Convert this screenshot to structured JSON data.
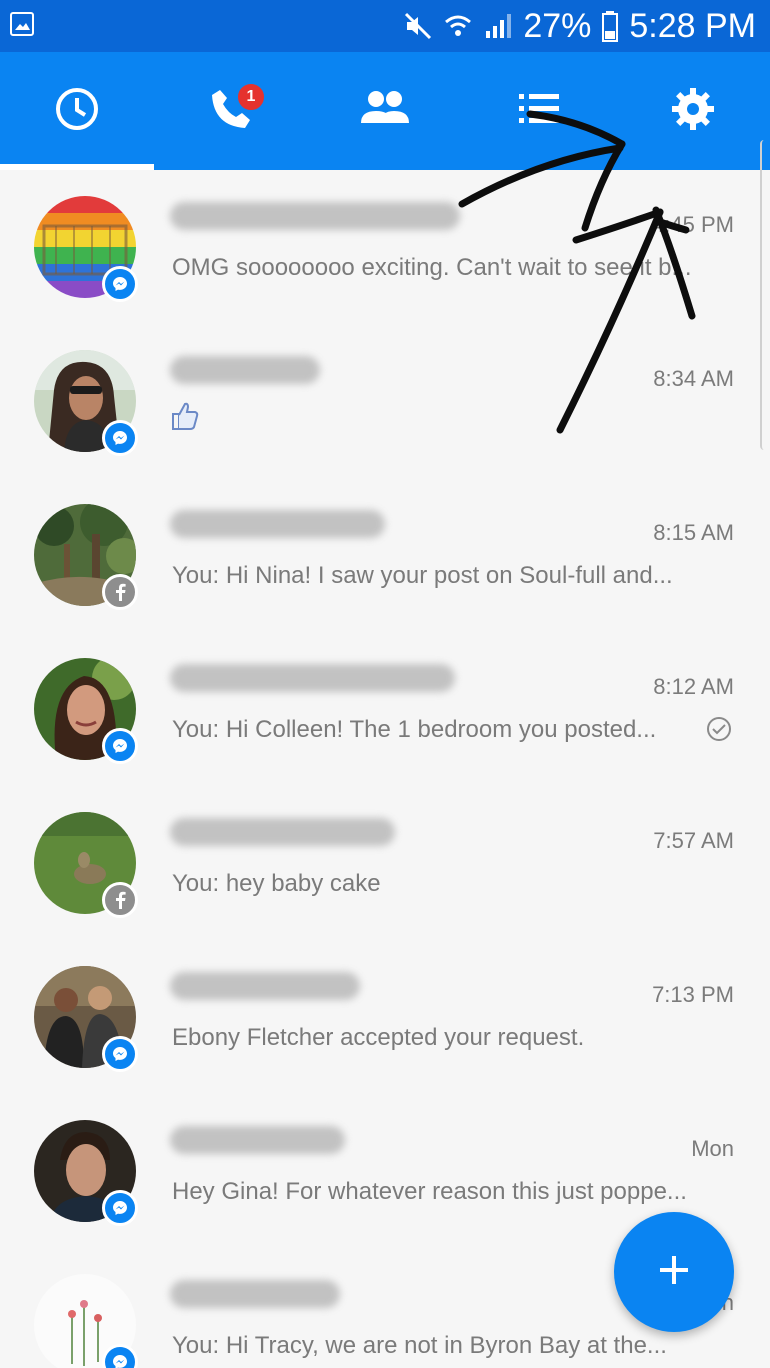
{
  "status_bar": {
    "battery": "27%",
    "time": "5:28 PM",
    "icons": [
      "image-icon",
      "mute-icon",
      "wifi-icon",
      "signal-icon",
      "battery-icon"
    ]
  },
  "tabs": [
    {
      "name": "recent",
      "icon": "clock-icon"
    },
    {
      "name": "calls",
      "icon": "phone-icon",
      "badge": "1"
    },
    {
      "name": "people",
      "icon": "people-icon"
    },
    {
      "name": "groups",
      "icon": "list-icon"
    },
    {
      "name": "settings",
      "icon": "gear-icon"
    }
  ],
  "conversations": [
    {
      "time": "4:45 PM",
      "preview": "OMG soooooooo exciting. Can't wait to see it b...",
      "badge": "messenger"
    },
    {
      "time": "8:34 AM",
      "preview": "",
      "badge": "messenger"
    },
    {
      "time": "8:15 AM",
      "preview": "You: Hi Nina! I saw your post on Soul-full and...",
      "badge": "facebook"
    },
    {
      "time": "8:12 AM",
      "preview": "You: Hi Colleen! The 1 bedroom you posted...",
      "badge": "messenger"
    },
    {
      "time": "7:57 AM",
      "preview": "You: hey baby cake",
      "badge": "facebook"
    },
    {
      "time": "7:13 PM",
      "preview": "Ebony Fletcher accepted your request.",
      "badge": "messenger"
    },
    {
      "time": "Mon",
      "preview": "Hey Gina! For whatever reason this just poppe...",
      "badge": "messenger"
    },
    {
      "time": "Mon",
      "preview": "You: Hi Tracy, we are not in Byron Bay at the...",
      "badge": "messenger"
    }
  ],
  "colors": {
    "status_bar": "#0a67d6",
    "tab_bar": "#0a84f2",
    "accent": "#0a84f2",
    "badge_red": "#e5322e"
  }
}
